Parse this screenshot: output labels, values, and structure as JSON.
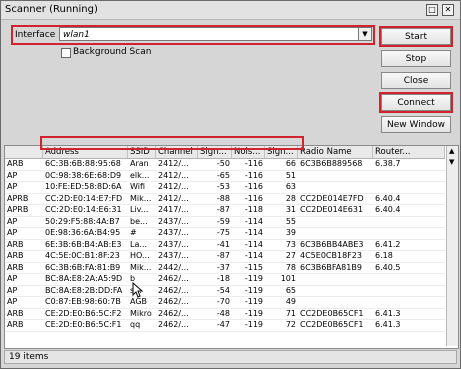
{
  "window": {
    "title": "Scanner (Running)",
    "minimize": "□",
    "close": "✕"
  },
  "interface": {
    "label": "Interface",
    "value": "wlan1",
    "dropdown": "▼"
  },
  "background_scan": {
    "label": "Background Scan",
    "checked": false
  },
  "buttons": {
    "start": "Start",
    "stop": "Stop",
    "close": "Close",
    "connect": "Connect",
    "new_window": "New Window"
  },
  "table": {
    "columns": [
      "",
      "Address",
      "SSID",
      "Channel",
      "Sign...",
      "Nois...",
      "Sign...",
      "Radio Name",
      "Router..."
    ],
    "rows": [
      [
        "ARB",
        "6C:3B:6B:88:95:68",
        "Aran",
        "2412/...",
        "-50",
        "-116",
        "66",
        "6C3B6B889568",
        "6.38.7"
      ],
      [
        "AP",
        "0C:98:38:6E:68:D9",
        "elk...",
        "2412/...",
        "-65",
        "-116",
        "51",
        "",
        ""
      ],
      [
        "AP",
        "10:FE:ED:58:8D:6A",
        "Wifi",
        "2412/...",
        "-53",
        "-116",
        "63",
        "",
        ""
      ],
      [
        "APRB",
        "CC:2D:E0:14:E7:FD",
        "Mik...",
        "2412/...",
        "-88",
        "-116",
        "28",
        "CC2DE014E7FD",
        "6.40.4"
      ],
      [
        "APRB",
        "CC:2D:E0:14:E6:31",
        "Liv...",
        "2417/...",
        "-87",
        "-118",
        "31",
        "CC2DE014E631",
        "6.40.4"
      ],
      [
        "AP",
        "50:29:F5:88:4A:B7",
        "be...",
        "2437/...",
        "-59",
        "-114",
        "55",
        "",
        ""
      ],
      [
        "AP",
        "0E:98:36:6A:B4:95",
        "#",
        "2437/...",
        "-75",
        "-114",
        "39",
        "",
        ""
      ],
      [
        "ARB",
        "6E:3B:6B:B4:AB:E3",
        "La...",
        "2437/...",
        "-41",
        "-114",
        "73",
        "6C3B6BB4ABE3",
        "6.41.2"
      ],
      [
        "ARB",
        "4C:5E:0C:B1:8F:23",
        "HO...",
        "2437/...",
        "-87",
        "-114",
        "27",
        "4C5E0CB18F23",
        "6.18"
      ],
      [
        "ARB",
        "6C:3B:6B:FA:81:B9",
        "Mik...",
        "2442/...",
        "-37",
        "-115",
        "78",
        "6C3B6BFA81B9",
        "6.40.5"
      ],
      [
        "AP",
        "BC:8A:E8:2A:A5:9D",
        "b",
        "2462/...",
        "-18",
        "-119",
        "101",
        "",
        ""
      ],
      [
        "AP",
        "BC:8A:E8:2B:DD:FA",
        "s...",
        "2462/...",
        "-54",
        "-119",
        "65",
        "",
        ""
      ],
      [
        "AP",
        "C0:87:EB:98:60:7B",
        "AGB",
        "2462/...",
        "-70",
        "-119",
        "49",
        "",
        ""
      ],
      [
        "ARB",
        "CE:2D:E0:B6:5C:F2",
        "Mikro",
        "2462/...",
        "-48",
        "-119",
        "71",
        "CC2DE0B65CF1",
        "6.41.3"
      ],
      [
        "ARB",
        "CE:2D:E0:B6:5C:F1",
        "qq",
        "2462/...",
        "-47",
        "-119",
        "72",
        "CC2DE0B65CF1",
        "6.41.3"
      ]
    ]
  },
  "status": {
    "items": "19 items"
  }
}
